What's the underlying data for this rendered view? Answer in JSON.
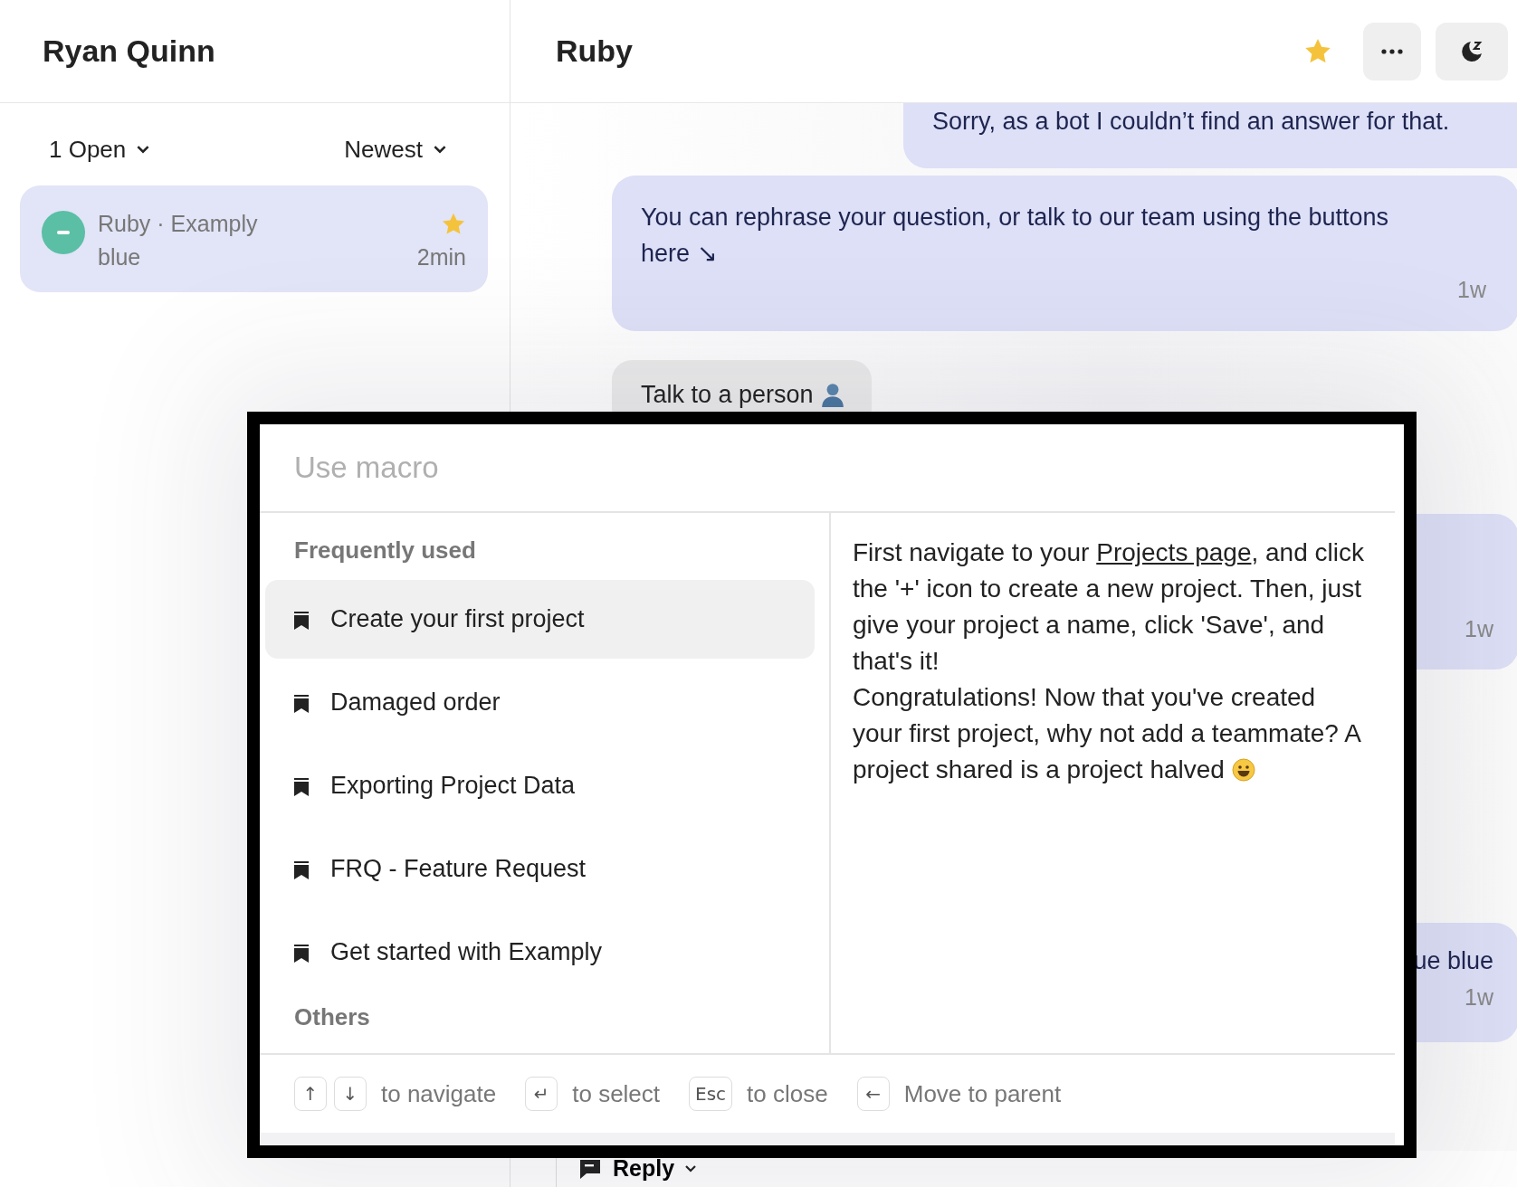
{
  "sidebar": {
    "title": "Ryan Quinn",
    "filters": [
      {
        "label": "1 Open"
      },
      {
        "label": "Newest"
      }
    ],
    "conversations": [
      {
        "name": "Ruby · Examply",
        "preview": "blue",
        "time": "2min",
        "starred": true,
        "selected": true
      }
    ]
  },
  "conversation": {
    "title": "Ruby",
    "starred": true,
    "actions": [
      {
        "kind": "more"
      },
      {
        "kind": "snooze"
      }
    ],
    "messages": [
      {
        "kind": "bubble",
        "text": "Sorry, as a bot I couldn’t find an answer for that."
      },
      {
        "kind": "bubble",
        "text": "You can rephrase your question, or talk to our team using the buttons here ↘",
        "time": "1w"
      },
      {
        "kind": "button",
        "text": "Talk to a person"
      },
      {
        "kind": "bubble",
        "time": "1w"
      },
      {
        "kind": "bubble",
        "text": "ue blue",
        "time": "1w"
      }
    ],
    "composer": {
      "mode": "Reply"
    }
  },
  "macro_picker": {
    "placeholder": "Use macro",
    "sections": [
      {
        "title": "Frequently used",
        "items": [
          {
            "label": "Create your first project",
            "selected": true
          },
          {
            "label": "Damaged order",
            "selected": false
          },
          {
            "label": "Exporting Project Data",
            "selected": false
          },
          {
            "label": "FRQ - Feature Request",
            "selected": false
          },
          {
            "label": "Get started with Examply",
            "selected": false
          }
        ]
      },
      {
        "title": "Others"
      }
    ],
    "preview": [
      {
        "before": "First navigate to your ",
        "link": "Projects page",
        "after": ", and click the '+' icon to create a new project. Then, just give your project a name, click 'Save', and that's it!"
      },
      {
        "before": "Congratulations! Now that you've created your first project, why not add a teammate? A project shared is a project halved"
      }
    ],
    "hints": [
      {
        "keys": [
          "↑",
          "↓"
        ],
        "label": "to navigate"
      },
      {
        "keys": [
          "↵"
        ],
        "label": "to select"
      },
      {
        "keys": [
          "Esc"
        ],
        "label": "to close"
      },
      {
        "keys": [
          "←"
        ],
        "label": "Move to parent"
      }
    ]
  }
}
